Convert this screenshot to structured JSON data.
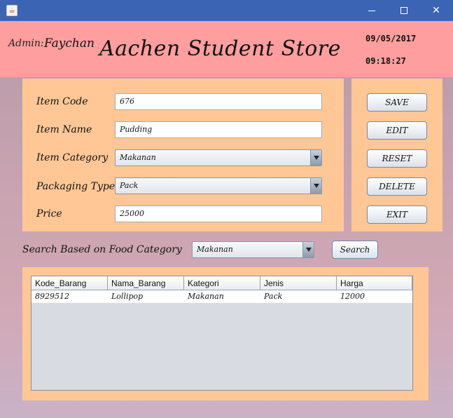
{
  "window": {
    "icon": "java-icon",
    "controls": {
      "minimize": "minimize-icon",
      "maximize": "maximize-icon",
      "close": "✕"
    }
  },
  "header": {
    "admin_label": "Admin:",
    "admin_name": "Faychan",
    "title": "Aachen Student Store",
    "date": "09/05/2017",
    "time": "09:18:27",
    "background_color": "#ff9e9e"
  },
  "form": {
    "item_code_label": "Item Code",
    "item_code_value": "676",
    "item_name_label": "Item Name",
    "item_name_value": "Pudding",
    "item_category_label": "Item Category",
    "item_category_value": "Makanan",
    "packaging_type_label": "Packaging Type",
    "packaging_type_value": "Pack",
    "price_label": "Price",
    "price_value": "25000",
    "panel_color": "#ffc796"
  },
  "buttons": {
    "save": "SAVE",
    "edit": "EDIT",
    "reset": "RESET",
    "delete": "DELETE",
    "exit": "EXIT"
  },
  "search": {
    "label": "Search Based on Food Category",
    "category_value": "Makanan",
    "button": "Search"
  },
  "table": {
    "columns": [
      "Kode_Barang",
      "Nama_Barang",
      "Kategori",
      "Jenis",
      "Harga"
    ],
    "rows": [
      [
        "8929512",
        "Lollipop",
        "Makanan",
        "Pack",
        "12000"
      ]
    ]
  }
}
